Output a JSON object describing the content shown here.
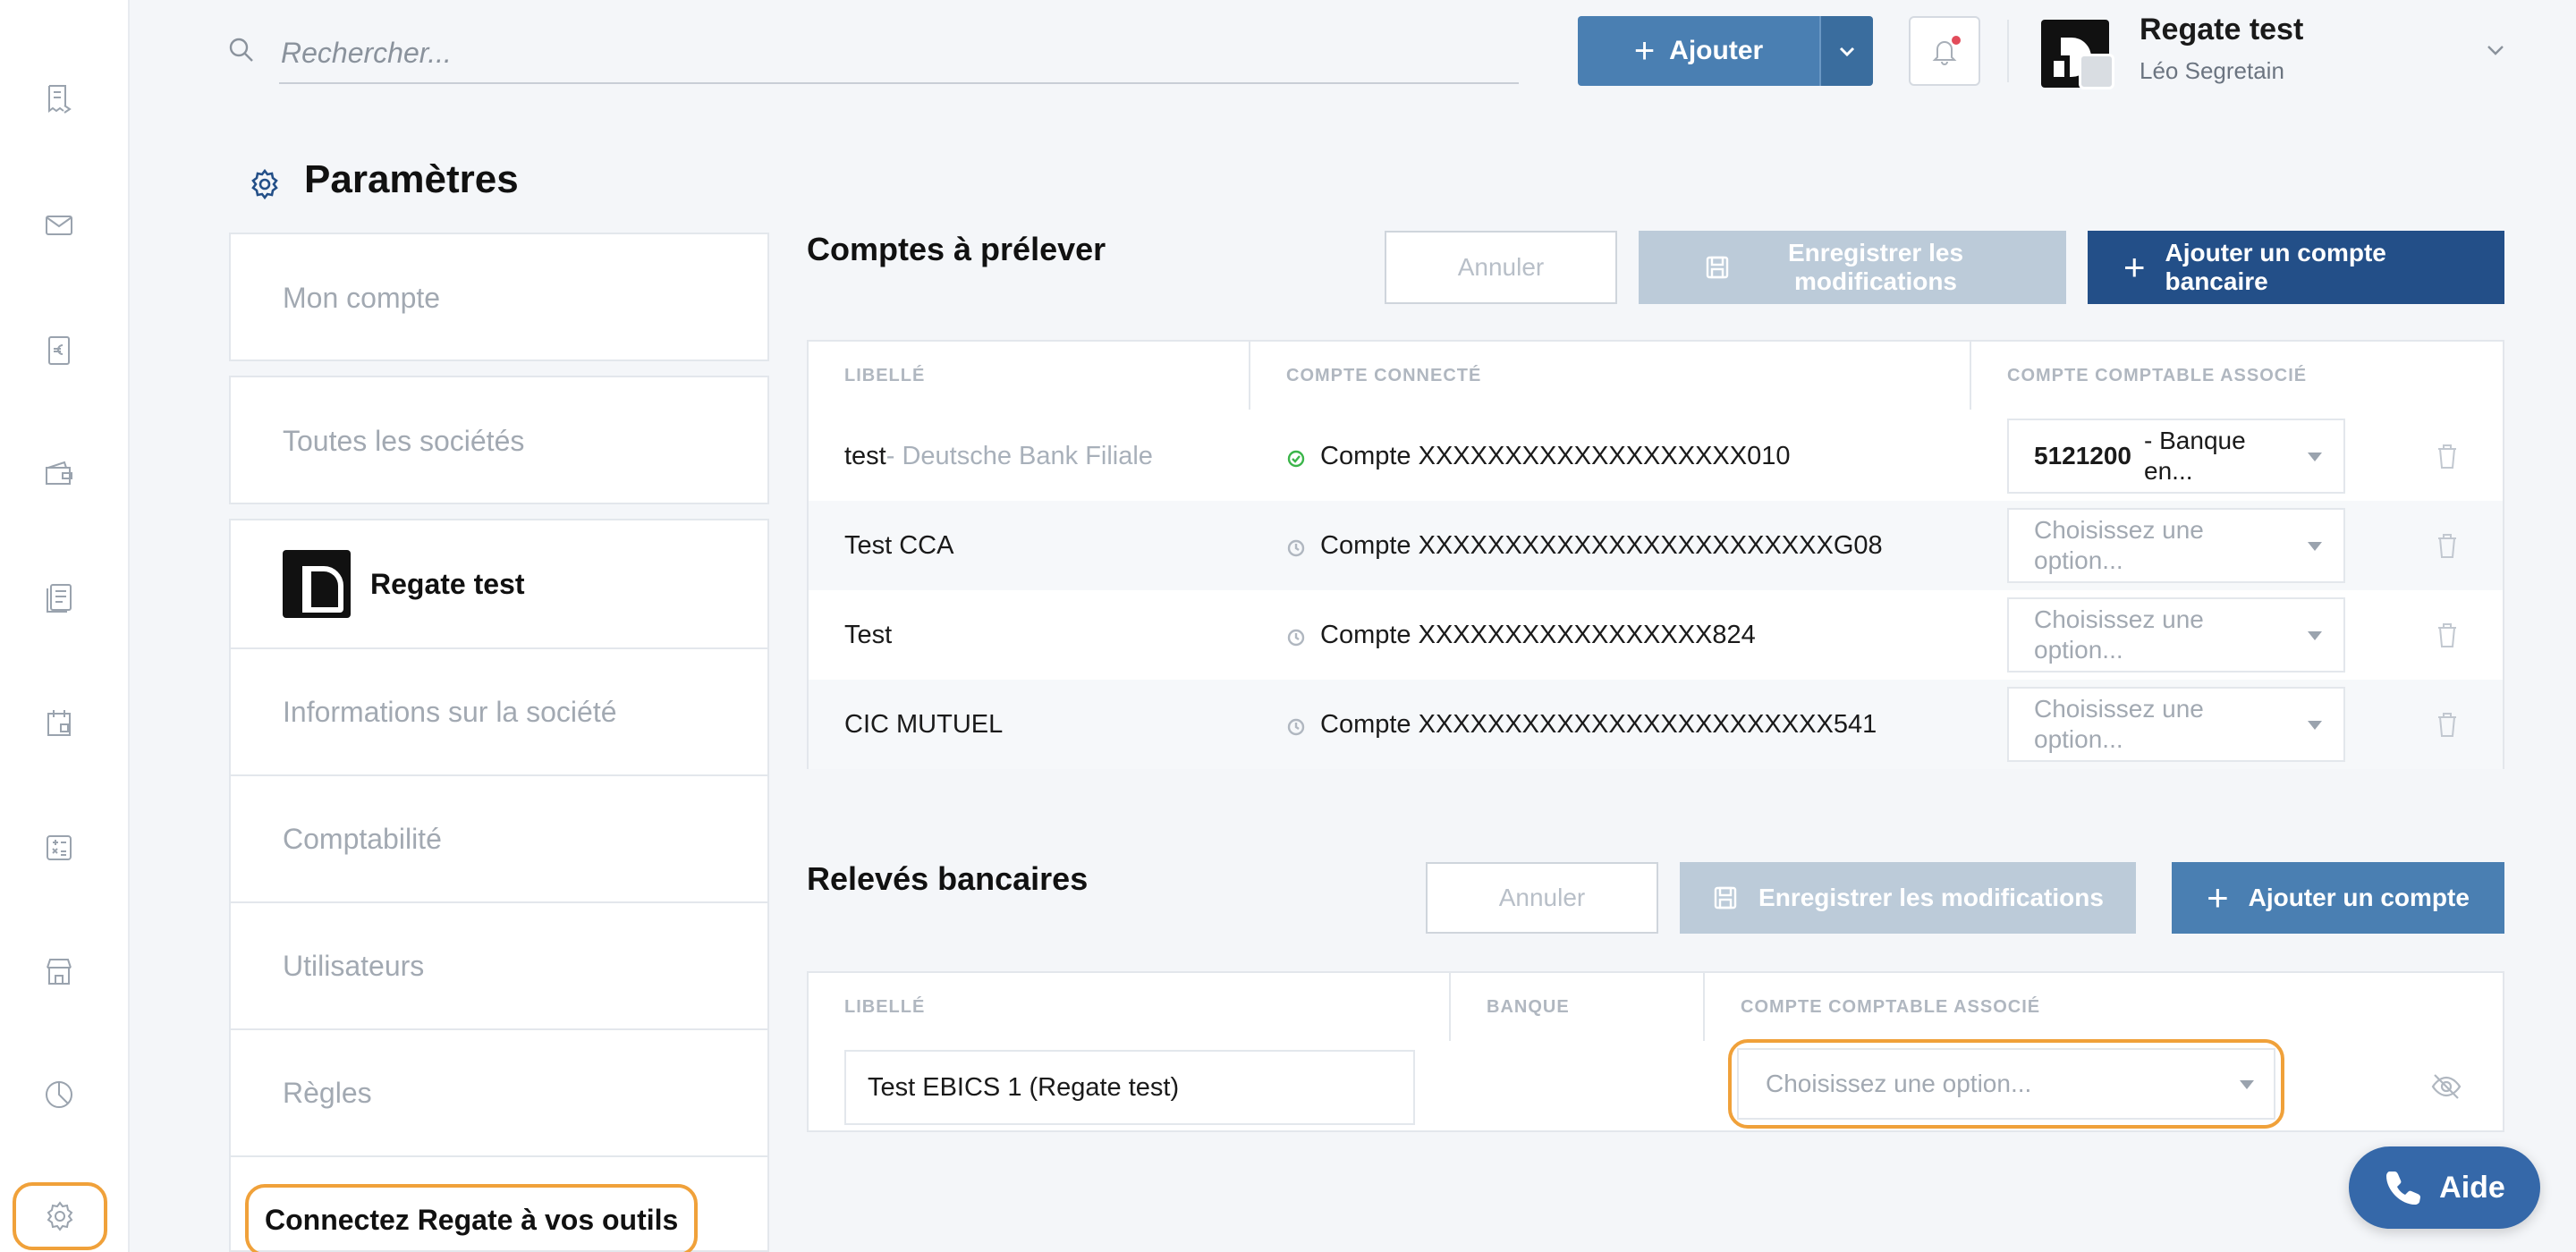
{
  "rail": {
    "items": [
      {
        "name": "rail-invoices-icon"
      },
      {
        "name": "rail-mail-icon"
      },
      {
        "name": "rail-euro-receipt-icon"
      },
      {
        "name": "rail-wallet-icon"
      },
      {
        "name": "rail-documents-icon"
      },
      {
        "name": "rail-calendar-icon"
      },
      {
        "name": "rail-calculator-icon"
      },
      {
        "name": "rail-store-icon"
      },
      {
        "name": "rail-pie-chart-icon"
      },
      {
        "name": "rail-settings-icon",
        "active": true
      }
    ]
  },
  "topbar": {
    "search_placeholder": "Rechercher...",
    "add_label": "Ajouter",
    "company": "Regate test",
    "user": "Léo Segretain"
  },
  "page": {
    "title": "Paramètres"
  },
  "nav": {
    "top_items": [
      "Mon compte",
      "Toutes les sociétés"
    ],
    "company_name": "Regate test",
    "company_items": [
      "Informations sur la société",
      "Comptabilité",
      "Utilisateurs",
      "Règles"
    ],
    "highlighted_item": "Connectez Regate à vos outils"
  },
  "debit_accounts": {
    "title": "Comptes à prélever",
    "cancel": "Annuler",
    "save": "Enregistrer les modifications",
    "add": "Ajouter un compte bancaire",
    "headers": [
      "Libellé",
      "Compte connecté",
      "Compte comptable associé"
    ],
    "rows": [
      {
        "label": "test",
        "bank": " - Deutsche Bank Filiale",
        "account": "Compte XXXXXXXXXXXXXXXXXXX010",
        "status": "connected",
        "ledger_code": "5121200",
        "ledger_label": " - Banque en...",
        "placeholder": ""
      },
      {
        "label": "Test CCA",
        "bank": "",
        "account": "Compte XXXXXXXXXXXXXXXXXXXXXXXXG08",
        "status": "pending",
        "ledger_code": "",
        "ledger_label": "",
        "placeholder": "Choisissez une option..."
      },
      {
        "label": "Test",
        "bank": "",
        "account": "Compte XXXXXXXXXXXXXXXXX824",
        "status": "pending",
        "ledger_code": "",
        "ledger_label": "",
        "placeholder": "Choisissez une option..."
      },
      {
        "label": "CIC MUTUEL",
        "bank": "",
        "account": "Compte XXXXXXXXXXXXXXXXXXXXXXXX541",
        "status": "pending",
        "ledger_code": "",
        "ledger_label": "",
        "placeholder": "Choisissez une option..."
      }
    ]
  },
  "bank_statements": {
    "title": "Relevés bancaires",
    "cancel": "Annuler",
    "save": "Enregistrer les modifications",
    "add": "Ajouter un compte",
    "headers": [
      "Libellé",
      "Banque",
      "Compte comptable associé"
    ],
    "row": {
      "label_value": "Test EBICS 1 (Regate test)",
      "bank": "",
      "ledger_placeholder": "Choisissez une option..."
    }
  },
  "help": {
    "label": "Aide"
  },
  "colors": {
    "primary": "#4a7fb2",
    "primary_dark": "#234f88",
    "highlight": "#f0a13a",
    "disabled": "#bccbd9",
    "connected": "#3bb54a"
  }
}
